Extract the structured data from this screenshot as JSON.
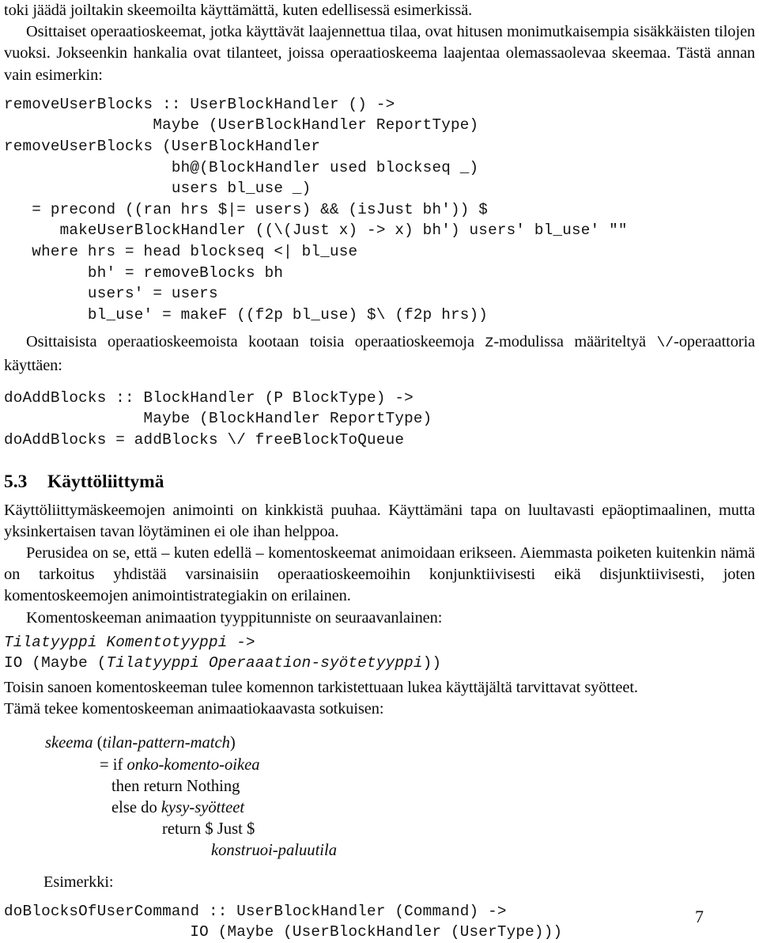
{
  "page": {
    "number": "7",
    "language": "fi"
  },
  "paragraphs": {
    "p1": "toki jäädä joiltakin skeemoilta käyttämättä, kuten edellisessä esimerkissä.",
    "p2": "Osittaiset operaatioskeemat, jotka käyttävät laajennettua tilaa, ovat hitusen monimutkaisempia sisäkkäisten tilojen vuoksi. Jokseenkin hankalia ovat tilanteet, joissa operaatioskeema laajentaa olemassaolevaa skeemaa. Tästä annan vain esimerkin:",
    "p3_pre": "Osittaisista operaatioskeemoista kootaan toisia operaatioskeemoja ",
    "p3_mono1": "Z",
    "p3_mid": "-modulissa määriteltyä ",
    "p3_mono2": "\\/",
    "p3_post": "-operaattoria käyttäen:",
    "p4": "Käyttöliittymäskeemojen animointi on kinkkistä puuhaa. Käyttämäni tapa on luultavasti epäoptimaalinen, mutta yksinkertaisen tavan löytäminen ei ole ihan helppoa.",
    "p5": "Perusidea on se, että – kuten edellä – komentoskeemat animoidaan erikseen. Aiemmasta poiketen kuitenkin nämä on tarkoitus yhdistää varsinaisiin operaatioskeemoihin konjunktiivisesti eikä disjunktiivisesti, joten komentoskeemojen animointistrategiakin on erilainen.",
    "p6": "Komentoskeeman animaation tyyppitunniste on seuraavanlainen:",
    "p7": "Toisin sanoen komentoskeeman tulee komennon tarkistettuaan lukea käyttäjältä tarvittavat syötteet.",
    "p8": "Tämä tekee komentoskeeman animaatiokaavasta sotkuisen:",
    "p9": "Esimerkki:"
  },
  "code_blocks": {
    "remove_user_blocks": "removeUserBlocks :: UserBlockHandler () ->\n                Maybe (UserBlockHandler ReportType)\nremoveUserBlocks (UserBlockHandler\n                  bh@(BlockHandler used blockseq _)\n                  users bl_use _)\n   = precond ((ran hrs $|= users) && (isJust bh')) $\n      makeUserBlockHandler ((\\(Just x) -> x) bh') users' bl_use' \"\"\n   where hrs = head blockseq <| bl_use\n         bh' = removeBlocks bh\n         users' = users\n         bl_use' = makeF ((f2p bl_use) $\\ (f2p hrs))",
    "do_add_blocks": "doAddBlocks :: BlockHandler (P BlockType) ->\n               Maybe (BlockHandler ReportType)\ndoAddBlocks = addBlocks \\/ freeBlockToQueue",
    "do_blocks_of_user_command": "doBlocksOfUserCommand :: UserBlockHandler (Command) ->\n                    IO (Maybe (UserBlockHandler (UserType)))"
  },
  "type_signature": {
    "line1": "Tilatyyppi Komentotyyppi ->",
    "line2_a": "IO (Maybe (",
    "line2_b": "Tilatyyppi Operaaation-syötetyyppi",
    "line2_c": "))"
  },
  "section": {
    "number": "5.3",
    "title": "Käyttöliittymä"
  },
  "pseudo_code": {
    "line1_a": "skeema",
    "line1_b": " (",
    "line1_c": "tilan-pattern-match",
    "line1_d": ")",
    "line2_a": "= if ",
    "line2_b": "onko-komento-oikea",
    "line3": "then return Nothing",
    "line4_a": "else do ",
    "line4_b": "kysy-syötteet",
    "line5": "return $ Just $",
    "line6": "konstruoi-paluutila"
  }
}
